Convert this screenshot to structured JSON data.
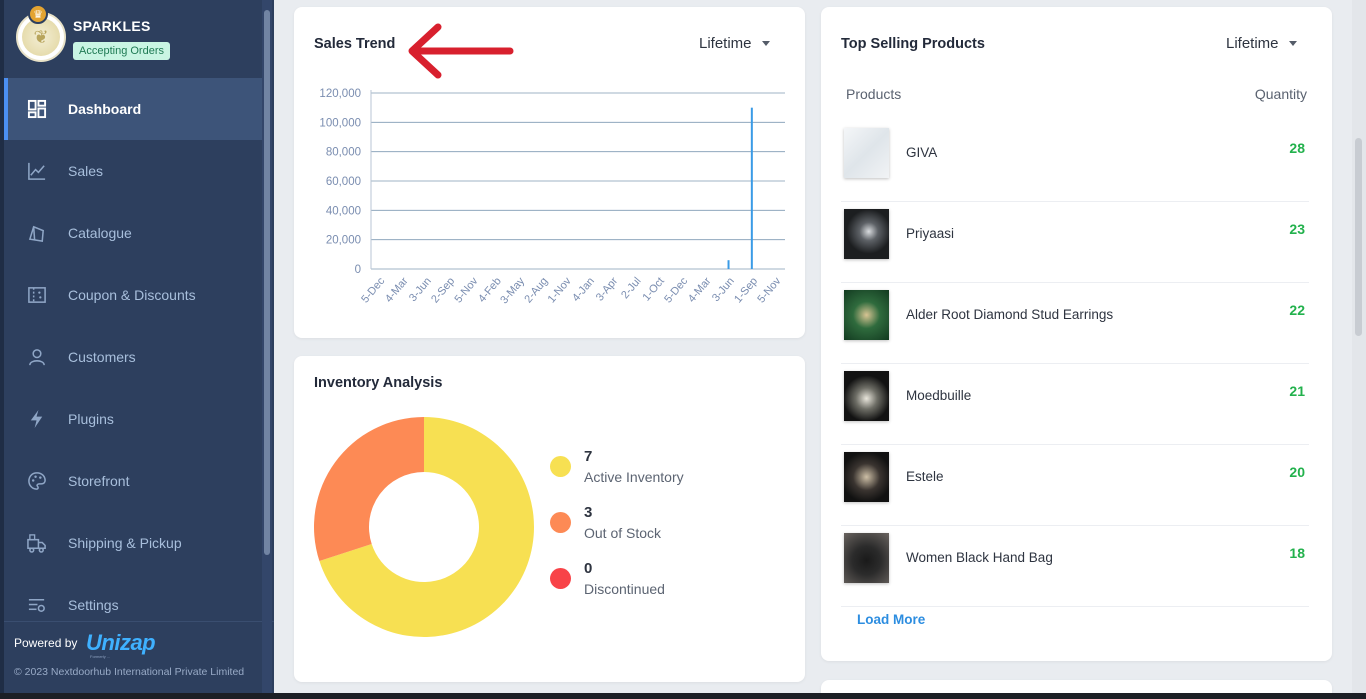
{
  "brand": {
    "name": "SPARKLES",
    "status": "Accepting Orders"
  },
  "sidebar": {
    "items": [
      {
        "label": "Dashboard",
        "icon": "dashboard-icon",
        "active": true
      },
      {
        "label": "Sales",
        "icon": "chart-line-icon"
      },
      {
        "label": "Catalogue",
        "icon": "tag-icon"
      },
      {
        "label": "Coupon & Discounts",
        "icon": "coupon-icon"
      },
      {
        "label": "Customers",
        "icon": "user-icon"
      },
      {
        "label": "Plugins",
        "icon": "lightning-icon"
      },
      {
        "label": "Storefront",
        "icon": "palette-icon"
      },
      {
        "label": "Shipping & Pickup",
        "icon": "delivery-icon"
      },
      {
        "label": "Settings",
        "icon": "sliders-icon"
      }
    ],
    "powered_by": "Powered by",
    "powered_brand": "Unizap",
    "powered_sub": "Formerly ...",
    "copyright": "© 2023 Nextdoorhub International Private Limited"
  },
  "sales_trend": {
    "title": "Sales Trend",
    "period": "Lifetime",
    "chart_data": {
      "type": "bar",
      "categories": [
        "5-Dec",
        "4-Mar",
        "3-Jun",
        "2-Sep",
        "5-Nov",
        "4-Feb",
        "3-May",
        "2-Aug",
        "1-Nov",
        "4-Jan",
        "3-Apr",
        "2-Jul",
        "1-Oct",
        "5-Dec",
        "4-Mar",
        "3-Jun",
        "1-Sep",
        "5-Nov"
      ],
      "values": [
        0,
        0,
        0,
        0,
        0,
        0,
        0,
        0,
        0,
        0,
        0,
        0,
        0,
        0,
        0,
        6000,
        110000,
        0
      ],
      "ylim": [
        0,
        120000
      ],
      "yticks": [
        "0",
        "20,000",
        "40,000",
        "60,000",
        "80,000",
        "100,000",
        "120,000"
      ],
      "grid": true,
      "color": "#3a9be6"
    }
  },
  "inventory": {
    "title": "Inventory Analysis",
    "chart_data": {
      "type": "pie",
      "donut": true,
      "slices": [
        {
          "label": "Active Inventory",
          "value": 7,
          "color": "#f7e052"
        },
        {
          "label": "Out of Stock",
          "value": 3,
          "color": "#fd8a55"
        },
        {
          "label": "Discontinued",
          "value": 0,
          "color": "#f84348"
        }
      ]
    }
  },
  "top_selling": {
    "title": "Top Selling Products",
    "period": "Lifetime",
    "col_products": "Products",
    "col_quantity": "Quantity",
    "rows": [
      {
        "name": "GIVA",
        "qty": "28"
      },
      {
        "name": "Priyaasi",
        "qty": "23"
      },
      {
        "name": "Alder Root Diamond Stud Earrings",
        "qty": "22"
      },
      {
        "name": "Moedbuille",
        "qty": "21"
      },
      {
        "name": "Estele",
        "qty": "20"
      },
      {
        "name": "Women Black Hand Bag",
        "qty": "18"
      }
    ],
    "load_more": "Load More"
  },
  "colors": {
    "sidebar": "#2d3f5e",
    "accent": "#4b8ff2",
    "qty_green": "#22b14c",
    "link": "#2c8de0",
    "annotation_arrow": "#d8202e"
  }
}
